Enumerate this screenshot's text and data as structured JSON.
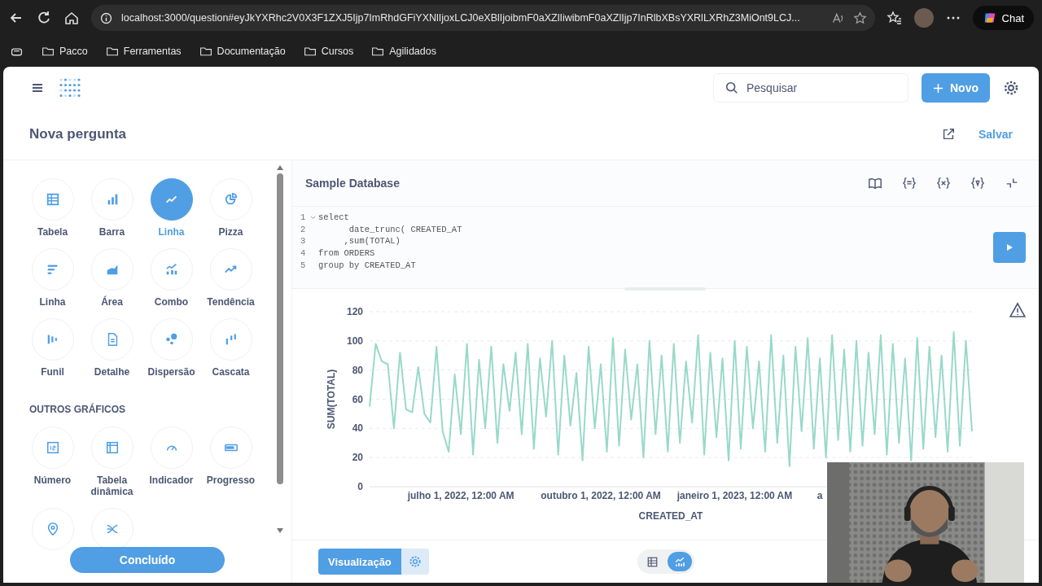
{
  "browser": {
    "url": "localhost:3000/question#eyJkYXRhc2V0X3F1ZXJ5Ijp7ImRhdGFiYXNlIjoxLCJ0eXBlIjoibmF0aXZlIiwibmF0aXZlIjp7InRlbXBsYXRlLXRhZ3MiOnt9LCJ...",
    "chat": "Chat",
    "bookmarks": [
      "Pacco",
      "Ferramentas",
      "Documentação",
      "Cursos",
      "Agilidados"
    ]
  },
  "header": {
    "search": {
      "placeholder": "Pesquisar"
    },
    "new_button": "Novo"
  },
  "question": {
    "title": "Nova pergunta",
    "save": "Salvar"
  },
  "sidebar": {
    "types": [
      {
        "label": "Tabela",
        "selected": false
      },
      {
        "label": "Barra",
        "selected": false
      },
      {
        "label": "Linha",
        "selected": true
      },
      {
        "label": "Pizza",
        "selected": false
      },
      {
        "label": "Linha",
        "selected": false
      },
      {
        "label": "Área",
        "selected": false
      },
      {
        "label": "Combo",
        "selected": false
      },
      {
        "label": "Tendência",
        "selected": false
      },
      {
        "label": "Funil",
        "selected": false
      },
      {
        "label": "Detalhe",
        "selected": false
      },
      {
        "label": "Dispersão",
        "selected": false
      },
      {
        "label": "Cascata",
        "selected": false
      }
    ],
    "section": "OUTROS GRÁFICOS",
    "others": [
      {
        "label": "Número",
        "selected": false
      },
      {
        "label": "Tabela dinâmica",
        "selected": false
      },
      {
        "label": "Indicador",
        "selected": false
      },
      {
        "label": "Progresso",
        "selected": false
      },
      {
        "selected": false
      },
      {
        "selected": false
      }
    ],
    "done": "Concluído"
  },
  "editor": {
    "database": "Sample Database",
    "lines": [
      {
        "number": "1",
        "text": "select",
        "foldable": true
      },
      {
        "number": "2",
        "text": "      date_trunc( CREATED_AT",
        "foldable": false
      },
      {
        "number": "3",
        "text": "     ,sum(TOTAL)",
        "foldable": false
      },
      {
        "number": "4",
        "text": "from ORDERS",
        "foldable": false
      },
      {
        "number": "5",
        "text": "group by CREATED_AT",
        "foldable": false
      }
    ]
  },
  "chart_data": {
    "type": "line",
    "xlabel": "CREATED_AT",
    "ylabel": "SUM(TOTAL)",
    "grid": true,
    "categories": [
      null,
      null,
      null,
      null,
      null,
      null,
      null,
      null,
      null,
      null,
      null,
      null,
      null,
      null,
      null,
      "julho 1, 2022, 12:00 AM",
      null,
      null,
      null,
      null,
      null,
      null,
      null,
      null,
      null,
      null,
      null,
      null,
      null,
      null,
      null,
      null,
      null,
      null,
      null,
      null,
      null,
      null,
      "outubro 1, 2022, 12:00 AM",
      null,
      null,
      null,
      null,
      null,
      null,
      null,
      null,
      null,
      null,
      null,
      null,
      null,
      null,
      null,
      null,
      null,
      null,
      null,
      null,
      null,
      "janeiro 1, 2023, 12:00 AM",
      null,
      null,
      null,
      null,
      null,
      null,
      null,
      null,
      null,
      null,
      null,
      null,
      null,
      "a",
      null,
      null,
      null,
      null,
      null,
      null,
      null,
      null,
      null,
      null,
      null,
      null,
      null,
      null,
      null,
      null,
      null,
      null,
      null,
      null,
      null,
      null,
      null,
      null,
      null
    ],
    "ylim": [
      0,
      120
    ],
    "yticks": [
      0,
      20,
      40,
      60,
      80,
      100,
      120
    ],
    "series": [
      {
        "color": "#98d9c9",
        "values": [
          55,
          98,
          86,
          84,
          40,
          92,
          53,
          51,
          82,
          50,
          44,
          96,
          38,
          24,
          77,
          36,
          98,
          22,
          87,
          40,
          96,
          30,
          84,
          52,
          92,
          36,
          98,
          26,
          88,
          48,
          100,
          22,
          90,
          42,
          78,
          18,
          96,
          40,
          84,
          24,
          102,
          28,
          94,
          46,
          84,
          20,
          100,
          36,
          90,
          24,
          98,
          30,
          86,
          44,
          104,
          22,
          92,
          34,
          88,
          18,
          100,
          26,
          96,
          40,
          86,
          24,
          104,
          30,
          90,
          14,
          96,
          38,
          102,
          26,
          88,
          20,
          104,
          32,
          94,
          24,
          100,
          28,
          92,
          36,
          104,
          22,
          98,
          30,
          88,
          18,
          102,
          26,
          96,
          34,
          90,
          24,
          106,
          28,
          100,
          38
        ]
      }
    ]
  },
  "footer": {
    "visualization": "Visualização",
    "views": [
      {
        "kind": "table",
        "selected": false
      },
      {
        "kind": "chart",
        "selected": true
      }
    ]
  }
}
